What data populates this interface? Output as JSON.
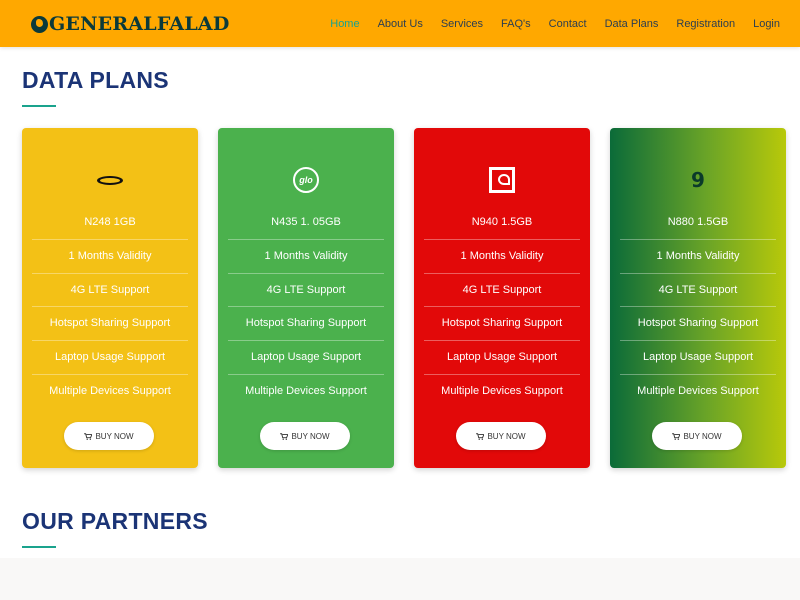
{
  "brand": {
    "name": "GENERALFALAD"
  },
  "nav": {
    "items": [
      {
        "label": "Home",
        "active": true
      },
      {
        "label": "About Us",
        "active": false
      },
      {
        "label": "Services",
        "active": false
      },
      {
        "label": "FAQ's",
        "active": false
      },
      {
        "label": "Contact",
        "active": false
      },
      {
        "label": "Data Plans",
        "active": false
      },
      {
        "label": "Registration",
        "active": false
      },
      {
        "label": "Login",
        "active": false
      }
    ]
  },
  "sections": {
    "data_plans_title": "DATA PLANS",
    "partners_title": "OUR PARTNERS"
  },
  "plans": [
    {
      "network_logo": "mtn-logo",
      "price_size": "N248 1GB",
      "features": [
        "1 Months Validity",
        "4G LTE Support",
        "Hotspot Sharing Support",
        "Laptop Usage Support",
        "Multiple Devices Support"
      ],
      "button_label": "BUY NOW",
      "color": "#f3c116"
    },
    {
      "network_logo": "glo-logo",
      "logo_text": "glo",
      "price_size": "N435 1. 05GB",
      "features": [
        "1 Months Validity",
        "4G LTE Support",
        "Hotspot Sharing Support",
        "Laptop Usage Support",
        "Multiple Devices Support"
      ],
      "button_label": "BUY NOW",
      "color": "#4bb14d"
    },
    {
      "network_logo": "airtel-logo",
      "price_size": "N940 1.5GB",
      "features": [
        "1 Months Validity",
        "4G LTE Support",
        "Hotspot Sharing Support",
        "Laptop Usage Support",
        "Multiple Devices Support"
      ],
      "button_label": "BUY NOW",
      "color": "#e20909"
    },
    {
      "network_logo": "9mobile-logo",
      "logo_text": "9",
      "price_size": "N880 1.5GB",
      "features": [
        "1 Months Validity",
        "4G LTE Support",
        "Hotspot Sharing Support",
        "Laptop Usage Support",
        "Multiple Devices Support"
      ],
      "button_label": "BUY NOW",
      "color": "#0b6b39"
    }
  ],
  "colors": {
    "header": "#ffa800",
    "title": "#1b3476",
    "accent": "#1aa38d"
  },
  "icons": {
    "cart": "shopping-cart-icon"
  }
}
